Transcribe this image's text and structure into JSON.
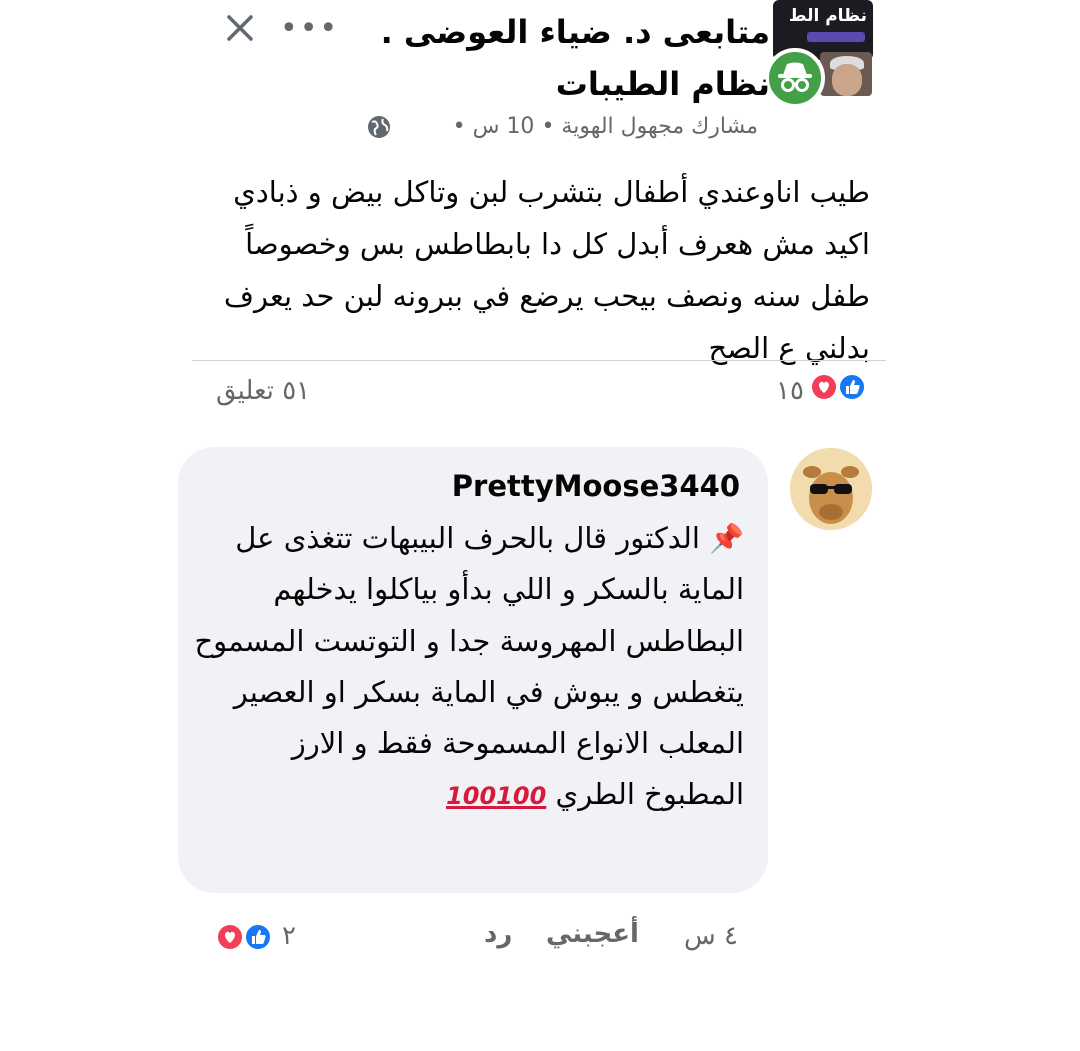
{
  "post": {
    "group_name_line1": "متابعى د. ضياء العوضى .",
    "group_name_line2": "نظام الطيبات",
    "group_thumb_text": "نظام الط",
    "author": "مشارك مجهول الهوية",
    "time": "10 س",
    "separator": "•",
    "more_icon": "more-dots-icon",
    "close_icon": "close-icon",
    "privacy_icon": "globe-icon",
    "text": "طيب اناوعندي أطفال بتشرب لبن وتاكل بيض و ذبادي اكيد مش هعرف أبدل كل دا بابطاطس بس وخصوصاً طفل سنه ونصف بيحب يرضع في ببرونه لبن حد يعرف بدلني ع الصح",
    "reactions_count": "١٥",
    "comments_count": "٥١ تعليق"
  },
  "comment": {
    "author": "PrettyMoose3440",
    "text": "الدكتور قال بالحرف البيبهات تتغذى عل الماية بالسكر و اللي بدأو بياكلوا يدخلهم البطاطس المهروسة جدا و التوتست المسموح يتغطس و يبوش في الماية بسكر او العصير المعلب الانواع المسموحة فقط و الارز المطبوخ الطري",
    "pin_emoji": "📌",
    "hundred_emoji": "100",
    "time": "٤ س",
    "like_label": "أعجبني",
    "reply_label": "رد",
    "reactions_count": "٢"
  },
  "colors": {
    "like_blue": "#1877f2",
    "love_red": "#f33e58",
    "anon_green": "#43a047",
    "secondary_text": "#65676b",
    "bubble_bg": "#f0f2f5"
  }
}
